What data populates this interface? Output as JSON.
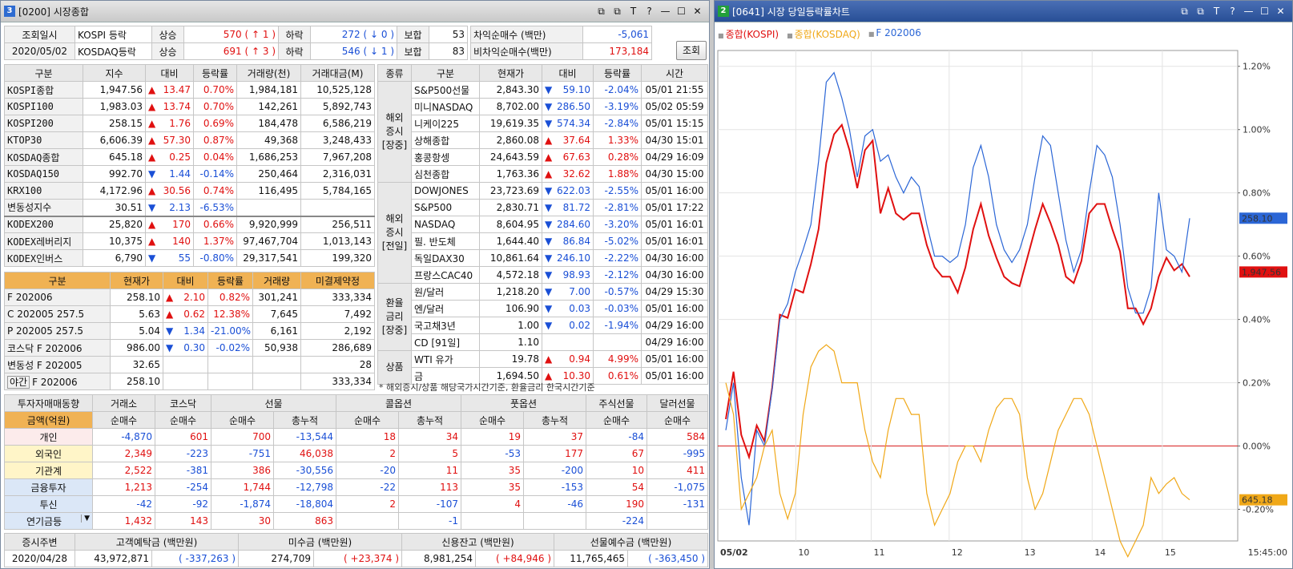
{
  "win1": {
    "num": "3",
    "title": "[0200] 시장종합"
  },
  "win2": {
    "num": "2",
    "title": "[0641] 시장 당일등락률차트"
  },
  "tbtns": [
    "⧉",
    "⧉",
    "T",
    "?",
    "—",
    "☐",
    "✕"
  ],
  "summary": {
    "date_label": "조회일시",
    "date": "2020/05/02",
    "rows": [
      {
        "mkt": "KOSPI 등락",
        "up_lbl": "상승",
        "up": "570",
        "up_chg": "1",
        "dn_lbl": "하락",
        "dn": "272",
        "dn_chg": "0",
        "flat_lbl": "보합",
        "flat": "53",
        "net_lbl": "차익순매수  (백만)",
        "net": "-5,061"
      },
      {
        "mkt": "KOSDAQ등락",
        "up_lbl": "상승",
        "up": "691",
        "up_chg": "3",
        "dn_lbl": "하락",
        "dn": "546",
        "dn_chg": "1",
        "flat_lbl": "보합",
        "flat": "83",
        "net_lbl": "비차익순매수(백만)",
        "net": "173,184"
      }
    ],
    "query_btn": "조회"
  },
  "idx": {
    "headers": [
      "구분",
      "지수",
      "대비",
      "등락률",
      "거래량(천)",
      "거래대금(M)"
    ],
    "rows": [
      [
        "KOSPI종합",
        "1,947.56",
        "up",
        "13.47",
        "0.70%",
        "1,984,181",
        "10,525,128"
      ],
      [
        "KOSPI100",
        "1,983.03",
        "up",
        "13.74",
        "0.70%",
        "142,261",
        "5,892,743"
      ],
      [
        "KOSPI200",
        "258.15",
        "up",
        "1.76",
        "0.69%",
        "184,478",
        "6,586,219"
      ],
      [
        "KTOP30",
        "6,606.39",
        "up",
        "57.30",
        "0.87%",
        "49,368",
        "3,248,433"
      ],
      [
        "KOSDAQ종합",
        "645.18",
        "up",
        "0.25",
        "0.04%",
        "1,686,253",
        "7,967,208"
      ],
      [
        "KOSDAQ150",
        "992.70",
        "dn",
        "1.44",
        "-0.14%",
        "250,464",
        "2,316,031"
      ],
      [
        "KRX100",
        "4,172.96",
        "up",
        "30.56",
        "0.74%",
        "116,495",
        "5,784,165"
      ],
      [
        "변동성지수",
        "30.51",
        "dn",
        "2.13",
        "-6.53%",
        "",
        ""
      ]
    ],
    "etf": [
      [
        "KODEX200",
        "25,820",
        "up",
        "170",
        "0.66%",
        "9,920,999",
        "256,511"
      ],
      [
        "KODEX레버리지",
        "10,375",
        "up",
        "140",
        "1.37%",
        "97,467,704",
        "1,013,143"
      ],
      [
        "KODEX인버스",
        "6,790",
        "dn",
        "55",
        "-0.80%",
        "29,317,541",
        "199,320"
      ]
    ]
  },
  "fut": {
    "headers": [
      "구분",
      "현재가",
      "대비",
      "등락률",
      "거래량",
      "미결제약정"
    ],
    "rows": [
      [
        "F 202006",
        "258.10",
        "up",
        "2.10",
        "0.82%",
        "301,241",
        "333,334"
      ],
      [
        "C 202005 257.5",
        "5.63",
        "up",
        "0.62",
        "12.38%",
        "7,645",
        "7,492"
      ],
      [
        "P 202005 257.5",
        "5.04",
        "dn",
        "1.34",
        "-21.00%",
        "6,161",
        "2,192"
      ],
      [
        "코스닥 F 202006",
        "986.00",
        "dn",
        "0.30",
        "-0.02%",
        "50,938",
        "286,689"
      ],
      [
        "변동성 F 202005",
        "32.65",
        "",
        "",
        "",
        "",
        "28"
      ]
    ],
    "night_lbl": "야간",
    "night_name": "F 202006",
    "night_price": "258.10",
    "night_oi": "333,334"
  },
  "world": {
    "headers": [
      "종류",
      "구분",
      "현재가",
      "대비",
      "등락률",
      "시간"
    ],
    "groups": [
      {
        "label": "해외 증시 [장중]",
        "rows": [
          [
            "S&P500선물",
            "2,843.30",
            "dn",
            "59.10",
            "-2.04%",
            "05/01 21:55"
          ],
          [
            "미니NASDAQ",
            "8,702.00",
            "dn",
            "286.50",
            "-3.19%",
            "05/02 05:59"
          ],
          [
            "니케이225",
            "19,619.35",
            "dn",
            "574.34",
            "-2.84%",
            "05/01 15:15"
          ],
          [
            "상해종합",
            "2,860.08",
            "up",
            "37.64",
            "1.33%",
            "04/30 15:01"
          ],
          [
            "홍콩항셍",
            "24,643.59",
            "up",
            "67.63",
            "0.28%",
            "04/29 16:09"
          ],
          [
            "심천종합",
            "1,763.36",
            "up",
            "32.62",
            "1.88%",
            "04/30 15:00"
          ]
        ]
      },
      {
        "label": "해외 증시 [전일]",
        "rows": [
          [
            "DOWJONES",
            "23,723.69",
            "dn",
            "622.03",
            "-2.55%",
            "05/01 16:00"
          ],
          [
            "S&P500",
            "2,830.71",
            "dn",
            "81.72",
            "-2.81%",
            "05/01 17:22"
          ],
          [
            "NASDAQ",
            "8,604.95",
            "dn",
            "284.60",
            "-3.20%",
            "05/01 16:01"
          ],
          [
            "필. 반도체",
            "1,644.40",
            "dn",
            "86.84",
            "-5.02%",
            "05/01 16:01"
          ],
          [
            "독일DAX30",
            "10,861.64",
            "dn",
            "246.10",
            "-2.22%",
            "04/30 16:00"
          ],
          [
            "프랑스CAC40",
            "4,572.18",
            "dn",
            "98.93",
            "-2.12%",
            "04/30 16:00"
          ]
        ]
      },
      {
        "label": "환율 금리 [장중]",
        "rows": [
          [
            "원/달러",
            "1,218.20",
            "dn",
            "7.00",
            "-0.57%",
            "04/29 15:30"
          ],
          [
            "엔/달러",
            "106.90",
            "dn",
            "0.03",
            "-0.03%",
            "05/01 16:00"
          ],
          [
            "국고채3년",
            "1.00",
            "dn",
            "0.02",
            "-1.94%",
            "04/29 16:00"
          ],
          [
            "CD [91일]",
            "1.10",
            "",
            "",
            "",
            "04/29 16:00"
          ]
        ]
      },
      {
        "label": "상품",
        "rows": [
          [
            "WTI 유가",
            "19.78",
            "up",
            "0.94",
            "4.99%",
            "05/01 16:00"
          ],
          [
            "금",
            "1,694.50",
            "up",
            "10.30",
            "0.61%",
            "05/01 16:00"
          ]
        ]
      }
    ],
    "note": "* 해외증시/상품 해당국가시간기준, 환율금리 한국시간기준"
  },
  "investor": {
    "title": "투자자매매동향",
    "unit": "금액(억원)",
    "groups": [
      "거래소",
      "코스닥",
      "선물",
      "콜옵션",
      "풋옵션",
      "주식선물",
      "달러선물"
    ],
    "sub": [
      "순매수",
      "순매수",
      "순매수",
      "총누적",
      "순매수",
      "총누적",
      "순매수",
      "총누적",
      "순매수",
      "순매수"
    ],
    "rows": [
      {
        "name": "개인",
        "cls": "pk",
        "v": [
          "-4,870",
          "601",
          "700",
          "-13,544",
          "18",
          "34",
          "19",
          "37",
          "-84",
          "584"
        ]
      },
      {
        "name": "외국인",
        "cls": "yl",
        "v": [
          "2,349",
          "-223",
          "-751",
          "46,038",
          "2",
          "5",
          "-53",
          "177",
          "67",
          "-995"
        ]
      },
      {
        "name": "기관계",
        "cls": "yl",
        "v": [
          "2,522",
          "-381",
          "386",
          "-30,556",
          "-20",
          "11",
          "35",
          "-200",
          "10",
          "411"
        ]
      },
      {
        "name": "금융투자",
        "cls": "bl",
        "v": [
          "1,213",
          "-254",
          "1,744",
          "-12,798",
          "-22",
          "113",
          "35",
          "-153",
          "54",
          "-1,075"
        ]
      },
      {
        "name": "투신",
        "cls": "bl",
        "v": [
          "-42",
          "-92",
          "-1,874",
          "-18,804",
          "2",
          "-107",
          "4",
          "-46",
          "190",
          "-131"
        ]
      },
      {
        "name": "연기금등",
        "cls": "bl",
        "v": [
          "1,432",
          "143",
          "30",
          "863",
          "",
          "-1",
          "",
          "",
          "-224",
          ""
        ]
      }
    ]
  },
  "weekly": {
    "title": "증시주변",
    "date": "2020/04/28",
    "items": [
      {
        "label": "고객예탁금 (백만원)",
        "val": "43,972,871",
        "chg": "-337,263"
      },
      {
        "label": "미수금 (백만원)",
        "val": "274,709",
        "chg": "+23,374"
      },
      {
        "label": "신용잔고 (백만원)",
        "val": "8,981,254",
        "chg": "+84,946"
      },
      {
        "label": "선물예수금 (백만원)",
        "val": "11,765,465",
        "chg": "-363,450"
      }
    ]
  },
  "chart_data": {
    "type": "line",
    "legend": [
      {
        "name": "종합(KOSPI)",
        "color": "#e01010"
      },
      {
        "name": "종합(KOSDAQ)",
        "color": "#f0a818"
      },
      {
        "name": "F 202006",
        "color": "#2b66d6"
      }
    ],
    "x_labels": [
      "05/02",
      "10",
      "11",
      "12",
      "13",
      "14",
      "15",
      "15:45:00"
    ],
    "y_ticks": [
      "1.20%",
      "1.00%",
      "0.80%",
      "0.60%",
      "0.40%",
      "0.20%",
      "0.00%",
      "-0.20%"
    ],
    "ylim": [
      -0.3,
      1.25
    ],
    "series": [
      {
        "name": "종합(KOSPI)",
        "color": "#e01010",
        "last_label": "1,947.56",
        "values": [
          0.1,
          0.22,
          0.05,
          -0.05,
          0.08,
          0.0,
          0.2,
          0.4,
          0.42,
          0.48,
          0.5,
          0.56,
          0.7,
          0.88,
          1.0,
          1.0,
          0.95,
          0.8,
          0.95,
          0.95,
          0.75,
          0.8,
          0.75,
          0.7,
          0.75,
          0.72,
          0.65,
          0.55,
          0.55,
          0.52,
          0.5,
          0.55,
          0.7,
          0.75,
          0.68,
          0.58,
          0.55,
          0.5,
          0.52,
          0.58,
          0.7,
          0.75,
          0.72,
          0.62,
          0.55,
          0.5,
          0.6,
          0.72,
          0.78,
          0.75,
          0.7,
          0.6,
          0.45,
          0.42,
          0.4,
          0.42,
          0.55,
          0.58,
          0.57,
          0.56,
          0.55
        ]
      },
      {
        "name": "F 202006",
        "color": "#2b66d6",
        "last_label": "258.10",
        "values": [
          0.05,
          0.2,
          -0.1,
          -0.25,
          0.05,
          0.0,
          0.18,
          0.4,
          0.45,
          0.55,
          0.62,
          0.7,
          0.9,
          1.15,
          1.18,
          1.1,
          1.0,
          0.85,
          0.98,
          1.0,
          0.9,
          0.92,
          0.85,
          0.8,
          0.85,
          0.82,
          0.7,
          0.6,
          0.6,
          0.58,
          0.6,
          0.7,
          0.88,
          0.95,
          0.85,
          0.7,
          0.62,
          0.58,
          0.62,
          0.7,
          0.85,
          0.98,
          0.95,
          0.8,
          0.65,
          0.55,
          0.62,
          0.8,
          0.95,
          0.92,
          0.85,
          0.7,
          0.5,
          0.42,
          0.42,
          0.5,
          0.8,
          0.62,
          0.6,
          0.55,
          0.72
        ]
      },
      {
        "name": "종합(KOSDAQ)",
        "color": "#f0a818",
        "last_label": "645.18",
        "values": [
          0.2,
          0.1,
          -0.2,
          -0.15,
          -0.1,
          0.0,
          0.05,
          -0.15,
          -0.23,
          -0.15,
          0.1,
          0.25,
          0.3,
          0.32,
          0.3,
          0.2,
          0.2,
          0.2,
          0.05,
          -0.05,
          -0.1,
          0.05,
          0.15,
          0.15,
          0.1,
          0.1,
          -0.15,
          -0.25,
          -0.2,
          -0.15,
          -0.05,
          0.0,
          0.0,
          -0.05,
          0.05,
          0.12,
          0.15,
          0.15,
          0.1,
          -0.1,
          -0.2,
          -0.15,
          -0.05,
          0.05,
          0.1,
          0.15,
          0.15,
          0.1,
          0.0,
          -0.1,
          -0.2,
          -0.3,
          -0.35,
          -0.3,
          -0.25,
          -0.1,
          -0.15,
          -0.12,
          -0.1,
          -0.15,
          -0.17
        ]
      }
    ]
  }
}
